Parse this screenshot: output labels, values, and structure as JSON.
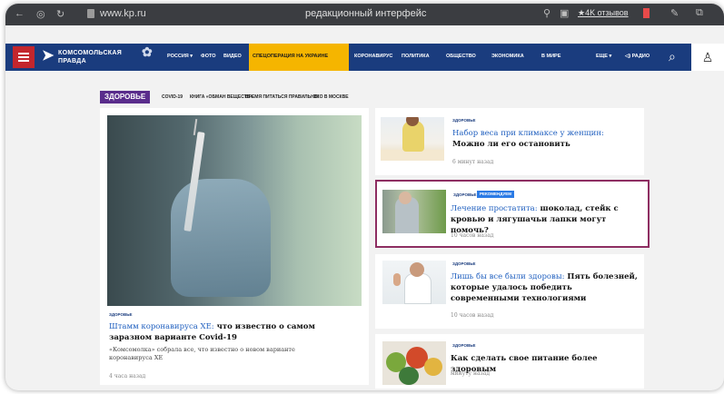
{
  "browser": {
    "url": "www.kp.ru",
    "title": "редакционный интерфейс",
    "reviews": "★4K отзывов"
  },
  "site": {
    "logo_line1": "КОМСОМОЛЬСКАЯ",
    "logo_line2": "ПРАВДА",
    "nav": [
      "РОССИЯ ▾",
      "ФОТО",
      "ВИДЕО",
      "СПЕЦОПЕРАЦИЯ НА УКРАИНЕ",
      "КОРОНАВИРУС",
      "ПОЛИТИКА",
      "ОБЩЕСТВО",
      "ЭКОНОМИКА",
      "В МИРЕ",
      "ЕЩЕ ▾",
      "◁) РАДИО"
    ],
    "colors": {
      "nav_bg": "#1a3c7e",
      "highlight": "#f5b500",
      "menu": "#c3262d",
      "section": "#5a2d8c",
      "link": "#1f5fbf"
    }
  },
  "section": {
    "label": "ЗДОРОВЬЕ",
    "crumbs": [
      "COVID-19",
      "КНИГА «ОБМАН ВЕЩЕСТВ»",
      "ВРЕМЯ ПИТАТЬСЯ ПРАВИЛЬНО!",
      "ЭКО В МОСКВЕ"
    ]
  },
  "hero": {
    "tag": "ЗДОРОВЬЕ",
    "title_blue": "Штамм коронавируса XE:",
    "title_rest": " что известно о самом заразном варианте Covid-19",
    "lead": "«Комсомолка» собрала все, что известно о новом варианте коронавируса XE",
    "time": "4 часа назад"
  },
  "articles": [
    {
      "tag": "ЗДОРОВЬЕ",
      "title_blue": "Набор веса при климаксе у женщин:",
      "title_rest": " Можно ли его остановить",
      "time": "6 минут назад"
    },
    {
      "tag": "ЗДОРОВЬЕ",
      "badge": "РЕКОМЕНДУЕМ",
      "title_blue": "Лечение простатита:",
      "title_rest": " шоколад, стейк с кровью и лягушачьи лапки могут помочь?",
      "time": "10 часов назад"
    },
    {
      "tag": "ЗДОРОВЬЕ",
      "title_blue": "Лишь бы все были здоровы:",
      "title_rest": " Пять болезней, которые удалось победить современными технологиями",
      "time": "10 часов назад"
    },
    {
      "tag": "ЗДОРОВЬЕ",
      "title_blue": "",
      "title_rest": "Как сделать свое питание более здоровым",
      "time": "минуту назад"
    }
  ]
}
